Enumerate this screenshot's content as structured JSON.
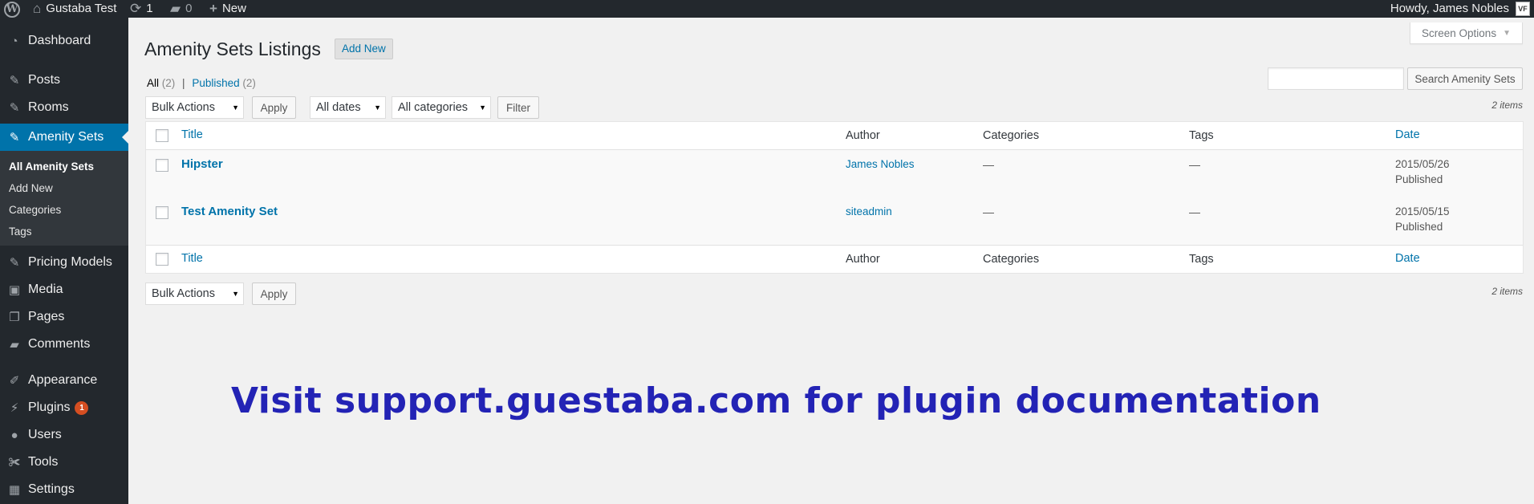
{
  "admin_bar": {
    "site_name": "Gustaba Test",
    "updates_count": "1",
    "comments_count": "0",
    "new_label": "New",
    "account_greeting": "Howdy, James Nobles",
    "avatar_initials": "VF"
  },
  "sidebar": {
    "items": [
      {
        "label": "Dashboard",
        "icon": "dashboard-icon"
      },
      {
        "label": "Posts",
        "icon": "pin-icon"
      },
      {
        "label": "Rooms",
        "icon": "pin-icon"
      },
      {
        "label": "Amenity Sets",
        "icon": "pin-icon"
      },
      {
        "label": "Pricing Models",
        "icon": "pin-icon"
      },
      {
        "label": "Media",
        "icon": "media-icon"
      },
      {
        "label": "Pages",
        "icon": "pages-icon"
      },
      {
        "label": "Comments",
        "icon": "comments-icon"
      },
      {
        "label": "Appearance",
        "icon": "brush-icon"
      },
      {
        "label": "Plugins",
        "icon": "plugin-icon",
        "badge": "1"
      },
      {
        "label": "Users",
        "icon": "users-icon"
      },
      {
        "label": "Tools",
        "icon": "wrench-icon"
      },
      {
        "label": "Settings",
        "icon": "settings-icon"
      }
    ],
    "submenu": [
      "All Amenity Sets",
      "Add New",
      "Categories",
      "Tags"
    ]
  },
  "page": {
    "title": "Amenity Sets Listings",
    "add_new_label": "Add New",
    "screen_options_label": "Screen Options"
  },
  "filters": {
    "all_label": "All",
    "all_count": "(2)",
    "separator": "|",
    "published_label": "Published",
    "published_count": "(2)",
    "search_button": "Search Amenity Sets",
    "search_value": "",
    "bulk_actions": "Bulk Actions",
    "apply": "Apply",
    "dates": "All dates",
    "categories": "All categories",
    "filter": "Filter",
    "items_count": "2 items"
  },
  "table": {
    "columns": [
      "Title",
      "Author",
      "Categories",
      "Tags",
      "Date"
    ],
    "rows": [
      {
        "title": "Hipster",
        "author": "James Nobles",
        "categories": "—",
        "tags": "—",
        "date": "2015/05/26",
        "status": "Published"
      },
      {
        "title": "Test Amenity Set",
        "author": "siteadmin",
        "categories": "—",
        "tags": "—",
        "date": "2015/05/15",
        "status": "Published"
      }
    ]
  },
  "promo_text": "Visit support.guestaba.com for plugin documentation",
  "colors": {
    "admin_dark": "#23282d",
    "accent_blue": "#0073aa",
    "promo_blue": "#2323b5",
    "badge_orange": "#d54e21"
  }
}
